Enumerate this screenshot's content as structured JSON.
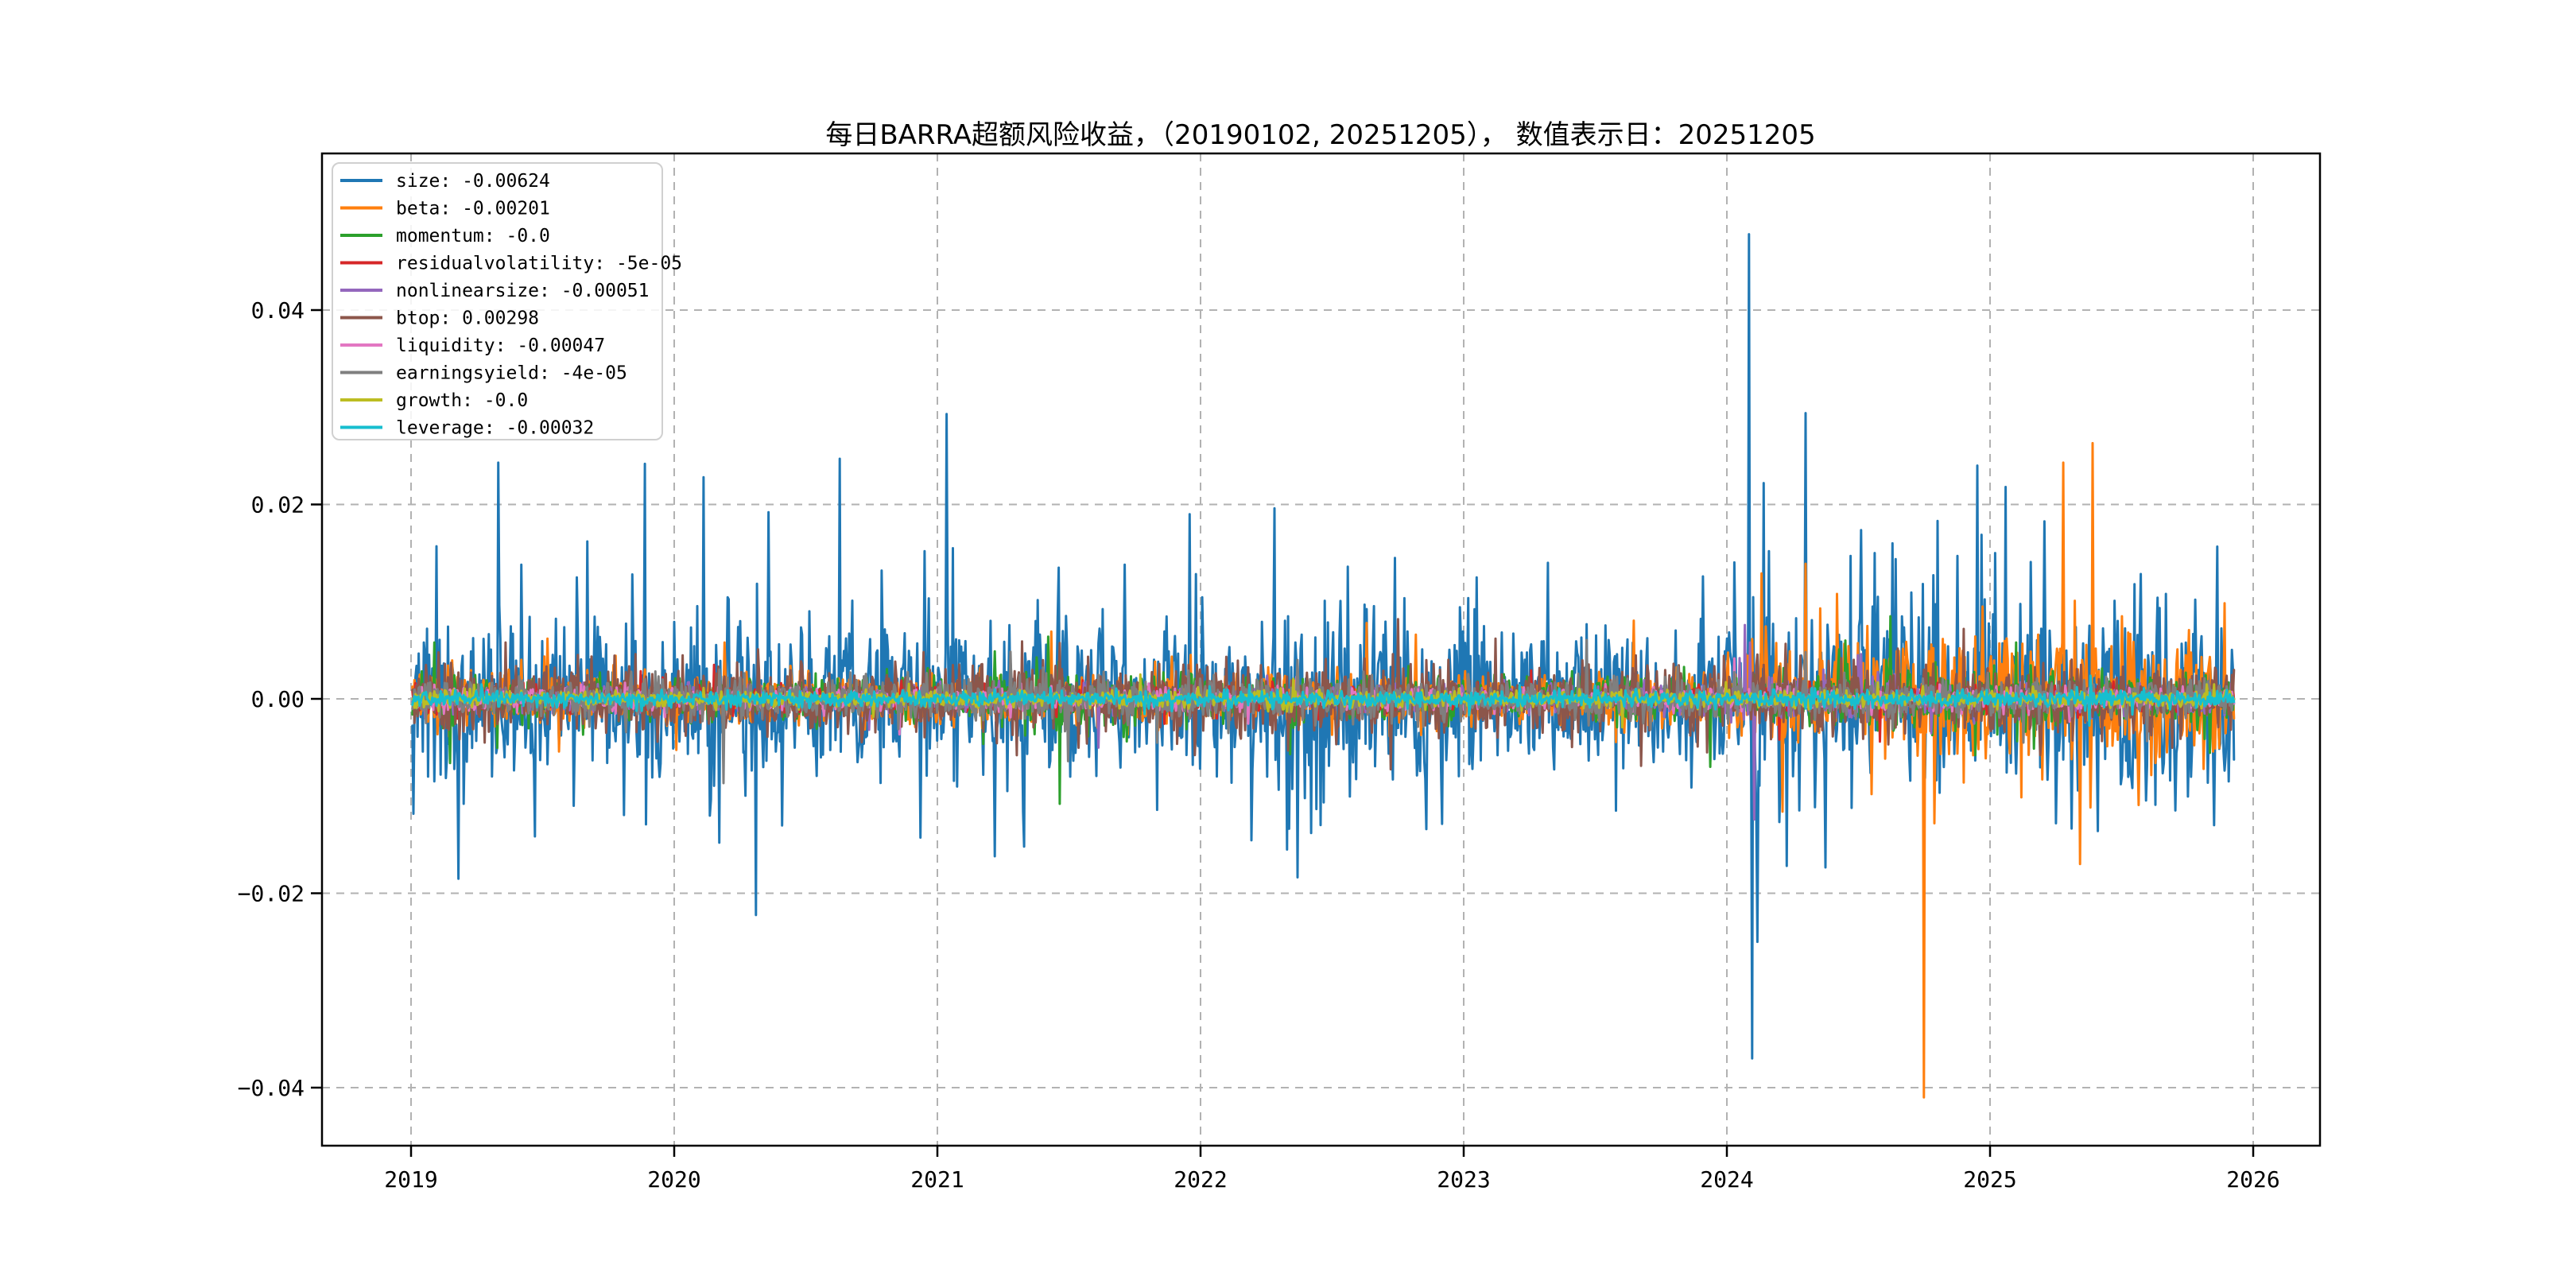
{
  "title": "每日BARRA超额风险收益，（20190102, 20251205），  数值表示日：20251205",
  "chart_data": {
    "type": "line",
    "title": "每日BARRA超额风险收益，（20190102, 20251205），  数值表示日：20251205",
    "date_range": [
      "20190102",
      "20251205"
    ],
    "value_label_date": "20251205",
    "xlabel": "",
    "ylabel": "",
    "grid": true,
    "grid_style": "dashed",
    "grid_color": "#b2b2b2",
    "spine_color": "#000000",
    "background_color": "#ffffff",
    "legend_position": "upper-left",
    "x_ticks": [
      2019,
      2020,
      2021,
      2022,
      2023,
      2024,
      2025,
      2026
    ],
    "x_tick_labels": [
      "2019",
      "2020",
      "2021",
      "2022",
      "2023",
      "2024",
      "2025",
      "2026"
    ],
    "y_ticks": [
      0.04,
      0.02,
      0.0,
      -0.02,
      -0.04
    ],
    "y_tick_labels": [
      "0.04",
      "0.02",
      "0.00",
      "−0.02",
      "−0.04"
    ],
    "xlim": [
      2018.66,
      2026.25
    ],
    "ylim": [
      -0.046,
      0.0561
    ],
    "x_start": 2019.005,
    "x_end": 2025.927,
    "n_points": 1740,
    "series": [
      {
        "name": "size",
        "label": "size: -0.00624",
        "color": "#1f77b4",
        "last_value": -0.00624,
        "base_std": 0.0042,
        "seed": 11,
        "era": [
          [
            2023.1,
            2023.95,
            0.8
          ],
          [
            2024.0,
            2026.0,
            1.15
          ]
        ],
        "events": [
          [
            2019.095,
            0.0157
          ],
          [
            2019.18,
            -0.0185
          ],
          [
            2019.33,
            0.0243
          ],
          [
            2019.42,
            0.0138
          ],
          [
            2019.63,
            0.0125
          ],
          [
            2019.67,
            0.0162
          ],
          [
            2019.84,
            0.0128
          ],
          [
            2020.11,
            0.0228
          ],
          [
            2020.17,
            -0.0148
          ],
          [
            2020.36,
            0.0192
          ],
          [
            2020.63,
            0.0247
          ],
          [
            2020.79,
            0.0132
          ],
          [
            2020.95,
            0.0152
          ],
          [
            2021.035,
            0.0293
          ],
          [
            2021.06,
            0.0155
          ],
          [
            2021.22,
            -0.0162
          ],
          [
            2021.33,
            -0.0152
          ],
          [
            2021.46,
            0.0135
          ],
          [
            2021.71,
            0.0138
          ],
          [
            2021.96,
            0.019
          ],
          [
            2022.28,
            0.0196
          ],
          [
            2022.33,
            -0.0155
          ],
          [
            2022.42,
            -0.0138
          ],
          [
            2022.56,
            0.0136
          ],
          [
            2022.74,
            0.0145
          ],
          [
            2022.86,
            -0.0134
          ],
          [
            2023.05,
            0.0125
          ],
          [
            2023.32,
            0.014
          ],
          [
            2023.58,
            -0.0115
          ],
          [
            2023.91,
            0.0126
          ],
          [
            2024.083,
            0.0478
          ],
          [
            2024.095,
            -0.037
          ],
          [
            2024.115,
            -0.025
          ],
          [
            2024.14,
            0.0222
          ],
          [
            2024.16,
            0.0152
          ],
          [
            2024.3,
            0.0294
          ],
          [
            2024.47,
            0.0147
          ],
          [
            2024.56,
            0.015
          ],
          [
            2024.63,
            0.016
          ],
          [
            2024.8,
            0.0183
          ],
          [
            2024.875,
            0.0147
          ],
          [
            2024.95,
            0.024
          ],
          [
            2025.02,
            0.015
          ],
          [
            2025.06,
            0.0218
          ],
          [
            2025.25,
            -0.0128
          ],
          [
            2025.41,
            -0.0136
          ],
          [
            2025.55,
            0.0118
          ],
          [
            2025.67,
            0.0108
          ],
          [
            2025.78,
            0.0102
          ],
          [
            2025.85,
            -0.013
          ]
        ]
      },
      {
        "name": "beta",
        "label": "beta: -0.00201",
        "color": "#ff7f0e",
        "last_value": -0.00201,
        "base_std": 0.00125,
        "seed": 22,
        "era": [
          [
            2019.0,
            2019.7,
            1.3
          ],
          [
            2024.0,
            2026.0,
            2.6
          ]
        ],
        "events": [
          [
            2019.52,
            0.0062
          ],
          [
            2020.19,
            0.0058
          ],
          [
            2022.63,
            0.0078
          ],
          [
            2022.82,
            0.0066
          ],
          [
            2024.13,
            0.0129
          ],
          [
            2024.21,
            -0.0116
          ],
          [
            2024.3,
            0.0139
          ],
          [
            2024.42,
            0.0108
          ],
          [
            2024.55,
            -0.0098
          ],
          [
            2024.75,
            -0.041
          ],
          [
            2024.79,
            -0.0128
          ],
          [
            2024.97,
            0.0095
          ],
          [
            2025.28,
            0.0243
          ],
          [
            2025.34,
            -0.017
          ],
          [
            2025.5,
            0.0085
          ]
        ]
      },
      {
        "name": "momentum",
        "label": "momentum: -0.0",
        "color": "#2ca02c",
        "last_value": -4e-06,
        "base_std": 0.0011,
        "seed": 33,
        "era": [
          [
            2021.3,
            2021.8,
            1.5
          ],
          [
            2024.3,
            2025.3,
            1.5
          ]
        ],
        "events": [
          [
            2019.09,
            0.0058
          ],
          [
            2019.15,
            -0.0066
          ],
          [
            2021.42,
            0.0064
          ],
          [
            2021.465,
            -0.0108
          ],
          [
            2024.45,
            0.006
          ],
          [
            2024.62,
            0.0085
          ],
          [
            2025.1,
            0.0058
          ]
        ]
      },
      {
        "name": "residualvolatility",
        "label": "residualvolatility: -5e-05",
        "color": "#d62728",
        "last_value": -5e-05,
        "base_std": 0.00065,
        "seed": 44,
        "era": [],
        "events": [
          [
            2020.15,
            0.0035
          ],
          [
            2024.2,
            -0.0042
          ]
        ]
      },
      {
        "name": "nonlinearsize",
        "label": "nonlinearsize: -0.00051",
        "color": "#9467bd",
        "last_value": -0.00051,
        "base_std": 0.0007,
        "seed": 55,
        "era": [
          [
            2024.0,
            2024.7,
            1.6
          ]
        ],
        "events": [
          [
            2024.05,
            0.0042
          ],
          [
            2024.07,
            0.0076
          ],
          [
            2024.09,
            0.0058
          ],
          [
            2024.105,
            -0.0124
          ],
          [
            2024.5,
            0.0045
          ]
        ]
      },
      {
        "name": "btop",
        "label": "btop: 0.00298",
        "color": "#8c564b",
        "last_value": 0.00298,
        "base_std": 0.00175,
        "seed": 66,
        "era": [],
        "events": [
          [
            2019.36,
            0.0058
          ],
          [
            2021.3,
            -0.0058
          ],
          [
            2022.75,
            0.0082
          ],
          [
            2023.12,
            0.0062
          ],
          [
            2024.9,
            0.0072
          ]
        ]
      },
      {
        "name": "liquidity",
        "label": "liquidity: -0.00047",
        "color": "#e377c2",
        "last_value": -0.00047,
        "base_std": 0.00055,
        "seed": 77,
        "era": [],
        "events": []
      },
      {
        "name": "earningsyield",
        "label": "earningsyield: -4e-05",
        "color": "#7f7f7f",
        "last_value": -4e-05,
        "base_std": 0.001,
        "seed": 88,
        "era": [],
        "events": [
          [
            2024.3,
            0.0048
          ]
        ]
      },
      {
        "name": "growth",
        "label": "growth: -0.0",
        "color": "#bcbd22",
        "last_value": -4e-06,
        "base_std": 0.00042,
        "seed": 99,
        "era": [],
        "events": []
      },
      {
        "name": "leverage",
        "label": "leverage: -0.00032",
        "color": "#17becf",
        "last_value": -0.00032,
        "base_std": 0.0004,
        "seed": 110,
        "era": [],
        "events": []
      }
    ]
  }
}
